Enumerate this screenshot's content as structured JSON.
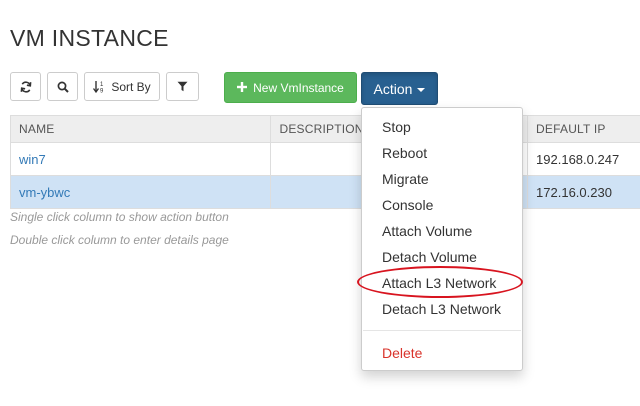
{
  "page": {
    "title": "VM INSTANCE"
  },
  "toolbar": {
    "refresh_icon": "refresh-icon",
    "search_icon": "search-icon",
    "sort_label": "Sort By",
    "sort_icon": "sort-numeric-icon",
    "filter_icon": "filter-icon",
    "new_label": "New VmInstance",
    "new_icon": "plus-icon",
    "action_label": "Action",
    "colors": {
      "new_bg": "#5cb85c",
      "action_bg": "#286090"
    }
  },
  "table": {
    "columns": [
      "NAME",
      "DESCRIPTION",
      "DEFAULT IP"
    ],
    "rows": [
      {
        "name": "win7",
        "description": "",
        "default_ip": "192.168.0.247",
        "selected": false
      },
      {
        "name": "vm-ybwc",
        "description": "",
        "default_ip": "172.16.0.230",
        "selected": true
      }
    ],
    "selected_row_color": "#cfe2f5"
  },
  "hints": [
    "Single click column to show action button",
    "Double click column to enter details page"
  ],
  "action_menu": {
    "items": [
      "Stop",
      "Reboot",
      "Migrate",
      "Console",
      "Attach Volume",
      "Detach Volume",
      "Attach L3 Network",
      "Detach L3 Network"
    ],
    "danger_item": "Delete",
    "highlighted_item": "Attach L3 Network",
    "highlight_color": "#d8141f"
  }
}
